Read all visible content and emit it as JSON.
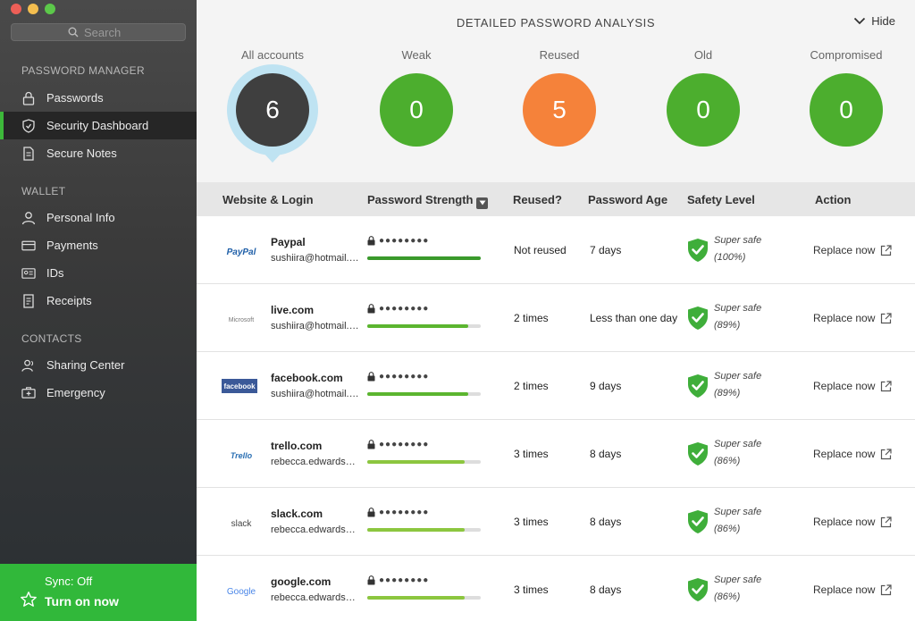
{
  "window": {
    "traffic_colors": [
      "#ed5f57",
      "#f4be4f",
      "#5cc84a"
    ]
  },
  "sidebar": {
    "search_placeholder": "Search",
    "sections": {
      "password_manager": "PASSWORD MANAGER",
      "wallet": "WALLET",
      "contacts": "CONTACTS"
    },
    "items": {
      "passwords": "Passwords",
      "security_dashboard": "Security Dashboard",
      "secure_notes": "Secure Notes",
      "personal_info": "Personal Info",
      "payments": "Payments",
      "ids": "IDs",
      "receipts": "Receipts",
      "sharing_center": "Sharing Center",
      "emergency": "Emergency"
    },
    "active_item": "security_dashboard",
    "sync": {
      "status": "Sync: Off",
      "action": "Turn on now",
      "color": "#31b83a"
    }
  },
  "header": {
    "title": "DETAILED PASSWORD ANALYSIS",
    "hide_label": "Hide",
    "stats": [
      {
        "label": "All accounts",
        "value": "6",
        "color": "#3f3f3f",
        "selected": true
      },
      {
        "label": "Weak",
        "value": "0",
        "color": "#4cae2e"
      },
      {
        "label": "Reused",
        "value": "5",
        "color": "#f5823a"
      },
      {
        "label": "Old",
        "value": "0",
        "color": "#4cae2e"
      },
      {
        "label": "Compromised",
        "value": "0",
        "color": "#4cae2e"
      }
    ]
  },
  "table": {
    "columns": {
      "site": "Website & Login",
      "strength": "Password Strength",
      "reused": "Reused?",
      "age": "Password Age",
      "safety": "Safety Level",
      "action": "Action"
    },
    "masked_password": "●●●●●●●●",
    "rows": [
      {
        "logo": "PayPal",
        "site": "Paypal",
        "login": "sushiira@hotmail.com",
        "strength": 1.0,
        "bar_color": "#3a9a2c",
        "reused": "Not reused",
        "age": "7 days",
        "safety": "Super safe",
        "percent": "(100%)",
        "action": "Replace now"
      },
      {
        "logo": "Microsoft",
        "site": "live.com",
        "login": "sushiira@hotmail.com",
        "strength": 0.89,
        "bar_color": "#5bb52f",
        "reused": "2 times",
        "age": "Less than one day",
        "safety": "Super safe",
        "percent": "(89%)",
        "action": "Replace now"
      },
      {
        "logo": "facebook",
        "site": "facebook.com",
        "login": "sushiira@hotmail.com",
        "strength": 0.89,
        "bar_color": "#5bb52f",
        "reused": "2 times",
        "age": "9 days",
        "safety": "Super safe",
        "percent": "(89%)",
        "action": "Replace now"
      },
      {
        "logo": "Trello",
        "site": "trello.com",
        "login": "rebecca.edwards@...",
        "strength": 0.86,
        "bar_color": "#8cc63f",
        "reused": "3 times",
        "age": "8 days",
        "safety": "Super safe",
        "percent": "(86%)",
        "action": "Replace now"
      },
      {
        "logo": "slack",
        "site": "slack.com",
        "login": "rebecca.edwards@...",
        "strength": 0.86,
        "bar_color": "#8cc63f",
        "reused": "3 times",
        "age": "8 days",
        "safety": "Super safe",
        "percent": "(86%)",
        "action": "Replace now"
      },
      {
        "logo": "Google",
        "site": "google.com",
        "login": "rebecca.edwards@...",
        "strength": 0.86,
        "bar_color": "#8cc63f",
        "reused": "3 times",
        "age": "8 days",
        "safety": "Super safe",
        "percent": "(86%)",
        "action": "Replace now"
      }
    ]
  }
}
